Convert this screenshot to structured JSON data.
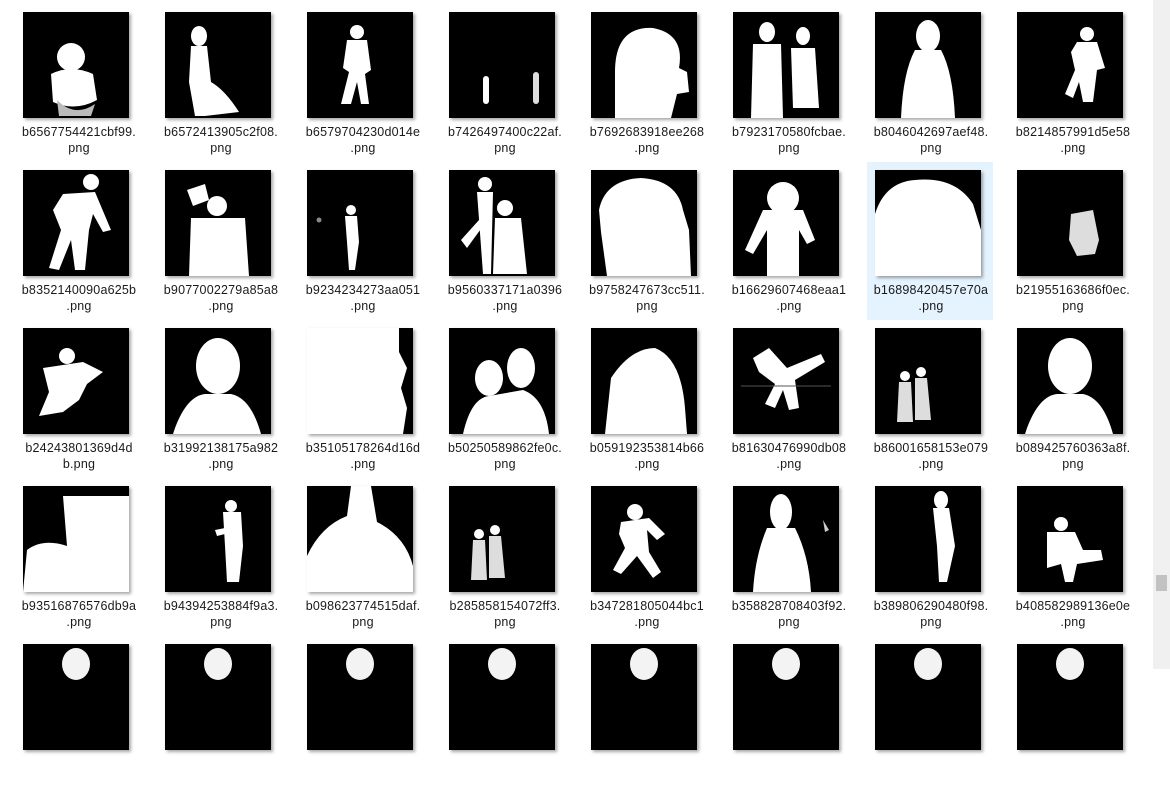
{
  "scrollbar": {
    "position": 0.88
  },
  "files": [
    {
      "line1": "b6567754421cbf99.",
      "line2": "png",
      "shape": "child",
      "selected": false
    },
    {
      "line1": "b6572413905c2f08.",
      "line2": "png",
      "shape": "standing-side",
      "selected": false
    },
    {
      "line1": "b6579704230d014e",
      "line2": ".png",
      "shape": "walker",
      "selected": false
    },
    {
      "line1": "b7426497400c22af.",
      "line2": "png",
      "shape": "tiny-pair",
      "selected": false
    },
    {
      "line1": "b7692683918ee268",
      "line2": ".png",
      "shape": "big-head",
      "selected": false
    },
    {
      "line1": "b7923170580fcbae.",
      "line2": "png",
      "shape": "couple",
      "selected": false
    },
    {
      "line1": "b8046042697aef48.",
      "line2": "png",
      "shape": "portrait",
      "selected": false
    },
    {
      "line1": "b8214857991d5e58",
      "line2": ".png",
      "shape": "dancer",
      "selected": false
    },
    {
      "line1": "b8352140090a625b",
      "line2": ".png",
      "shape": "bending",
      "selected": false
    },
    {
      "line1": "b9077002279a85a8",
      "line2": ".png",
      "shape": "torso-sign",
      "selected": false
    },
    {
      "line1": "b9234234273aa051",
      "line2": ".png",
      "shape": "slim-standing",
      "selected": false
    },
    {
      "line1": "b9560337171a0396",
      "line2": ".png",
      "shape": "pair-action",
      "selected": false
    },
    {
      "line1": "b9758247673cc511.",
      "line2": "png",
      "shape": "large-torso",
      "selected": false
    },
    {
      "line1": "b16629607468eaa1",
      "line2": ".png",
      "shape": "arms-out",
      "selected": false
    },
    {
      "line1": "b16898420457e70a",
      "line2": ".png",
      "shape": "cloud",
      "selected": true
    },
    {
      "line1": "b21955163686f0ec.",
      "line2": "png",
      "shape": "group-small",
      "selected": false
    },
    {
      "line1": "b24243801369d4d",
      "line2": "b.png",
      "shape": "lying",
      "selected": false
    },
    {
      "line1": "b31992138175a982",
      "line2": ".png",
      "shape": "bust",
      "selected": false
    },
    {
      "line1": "b35105178264d16d",
      "line2": ".png",
      "shape": "white-fill",
      "selected": false
    },
    {
      "line1": "b50250589862fe0c.",
      "line2": "png",
      "shape": "two-heads",
      "selected": false
    },
    {
      "line1": "b059192353814b66",
      "line2": ".png",
      "shape": "thumbs",
      "selected": false
    },
    {
      "line1": "b81630476990db08",
      "line2": ".png",
      "shape": "flying",
      "selected": false
    },
    {
      "line1": "b86001658153e079",
      "line2": ".png",
      "shape": "duo-small",
      "selected": false
    },
    {
      "line1": "b089425760363a8f.",
      "line2": "png",
      "shape": "bust",
      "selected": false
    },
    {
      "line1": "b93516876576db9a",
      "line2": ".png",
      "shape": "blob-right",
      "selected": false
    },
    {
      "line1": "b94394253884f9a3.",
      "line2": "png",
      "shape": "walker-small",
      "selected": false
    },
    {
      "line1": "b098623774515daf.",
      "line2": "png",
      "shape": "big-lean",
      "selected": false
    },
    {
      "line1": "b285858154072ff3.",
      "line2": "png",
      "shape": "duo-small",
      "selected": false
    },
    {
      "line1": "b347281805044bc1",
      "line2": ".png",
      "shape": "squat",
      "selected": false
    },
    {
      "line1": "b358828708403f92.",
      "line2": "png",
      "shape": "cone-head",
      "selected": false
    },
    {
      "line1": "b389806290480f98.",
      "line2": "png",
      "shape": "slim-walk",
      "selected": false
    },
    {
      "line1": "b408582989136e0e",
      "line2": ".png",
      "shape": "kicker",
      "selected": false
    },
    {
      "line1": "",
      "line2": "",
      "shape": "partial",
      "selected": false
    },
    {
      "line1": "",
      "line2": "",
      "shape": "partial",
      "selected": false
    },
    {
      "line1": "",
      "line2": "",
      "shape": "partial",
      "selected": false
    },
    {
      "line1": "",
      "line2": "",
      "shape": "partial",
      "selected": false
    },
    {
      "line1": "",
      "line2": "",
      "shape": "partial",
      "selected": false
    },
    {
      "line1": "",
      "line2": "",
      "shape": "partial",
      "selected": false
    },
    {
      "line1": "",
      "line2": "",
      "shape": "partial",
      "selected": false
    },
    {
      "line1": "",
      "line2": "",
      "shape": "partial",
      "selected": false
    }
  ]
}
